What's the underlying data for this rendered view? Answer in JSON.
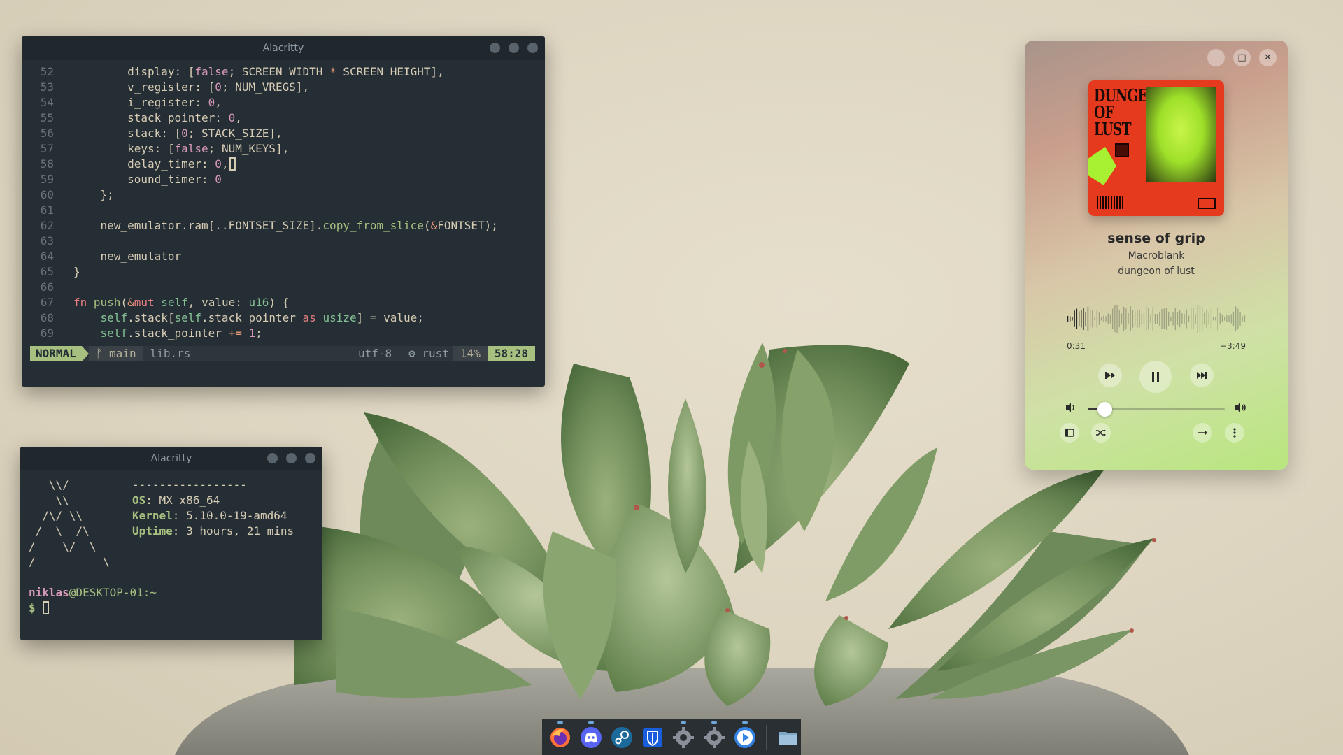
{
  "editor_window": {
    "title": "Alacritty",
    "code_lines": [
      {
        "n": "52",
        "html": "        display: [<span class=\"bool\">false</span>; SCREEN_WIDTH <span class=\"op\">*</span> SCREEN_HEIGHT],"
      },
      {
        "n": "53",
        "html": "        v_register: [<span class=\"num\">0</span>; NUM_VREGS],"
      },
      {
        "n": "54",
        "html": "        i_register: <span class=\"num\">0</span>,"
      },
      {
        "n": "55",
        "html": "        stack_pointer: <span class=\"num\">0</span>,"
      },
      {
        "n": "56",
        "html": "        stack: [<span class=\"num\">0</span>; STACK_SIZE],"
      },
      {
        "n": "57",
        "html": "        keys: [<span class=\"bool\">false</span>; NUM_KEYS],"
      },
      {
        "n": "58",
        "html": "        delay_timer: <span class=\"num\">0</span>,<span class=\"cursor-box\"></span>"
      },
      {
        "n": "59",
        "html": "        sound_timer: <span class=\"num\">0</span>"
      },
      {
        "n": "60",
        "html": "    };"
      },
      {
        "n": "61",
        "html": ""
      },
      {
        "n": "62",
        "html": "    new_emulator.ram[..FONTSET_SIZE].<span class=\"fn\">copy_from_slice</span>(<span class=\"op\">&amp;</span>FONTSET);"
      },
      {
        "n": "63",
        "html": ""
      },
      {
        "n": "64",
        "html": "    new_emulator"
      },
      {
        "n": "65",
        "html": "}"
      },
      {
        "n": "66",
        "html": ""
      },
      {
        "n": "67",
        "html": "<span class=\"kw\">fn</span> <span class=\"fn\">push</span>(<span class=\"op\">&amp;</span><span class=\"kw\">mut</span> <span class=\"ty\">self</span>, value: <span class=\"ty\">u16</span>) {"
      },
      {
        "n": "68",
        "html": "    <span class=\"ty\">self</span>.stack[<span class=\"ty\">self</span>.stack_pointer <span class=\"kw\">as</span> <span class=\"ty\">usize</span>] = value;"
      },
      {
        "n": "69",
        "html": "    <span class=\"ty\">self</span>.stack_pointer <span class=\"op\">+=</span> <span class=\"num\">1</span>;"
      }
    ],
    "status": {
      "mode": "NORMAL",
      "branch_icon": "ᚠ",
      "branch": "main",
      "file": "lib.rs",
      "encoding": "utf-8",
      "os_icon": "",
      "filetype_icon": "⚙",
      "filetype": "rust",
      "percent": "14%",
      "position": "58:28"
    }
  },
  "fetch_window": {
    "title": "Alacritty",
    "logo": "   \\\\/\n    \\\\\n  /\\/ \\\\\n /  \\  /\\\n/    \\/  \\\n/__________\\",
    "separator": "-----------------",
    "os_label": "OS",
    "os_value": "MX x86_64",
    "kernel_label": "Kernel",
    "kernel_value": "5.10.0-19-amd64",
    "uptime_label": "Uptime",
    "uptime_value": "3 hours, 21 mins",
    "prompt_user": "niklas",
    "prompt_host": "@DESKTOP-01:~",
    "prompt_symbol": "$"
  },
  "player": {
    "album_cover_title": "DUNGEON OF LUST",
    "track_title": "sense of grip",
    "artist": "Macroblank",
    "album": "dungeon of lust",
    "time_elapsed": "0:31",
    "time_remaining": "−3:49",
    "progress": 0.12,
    "volume": 0.12,
    "minimize_icon": "_",
    "maximize_icon": "□",
    "close_icon": "✕"
  },
  "dock": {
    "apps": [
      {
        "name": "firefox",
        "color": "#ff7139",
        "running": true
      },
      {
        "name": "discord",
        "color": "#5865f2",
        "running": true
      },
      {
        "name": "steam",
        "color": "#1b6a9a",
        "running": false
      },
      {
        "name": "bitwarden",
        "color": "#175ddc",
        "running": false
      },
      {
        "name": "settings",
        "color": "#8a9099",
        "running": true
      },
      {
        "name": "settings-2",
        "color": "#8a9099",
        "running": true
      },
      {
        "name": "media-player",
        "color": "#3584e4",
        "running": true
      },
      {
        "name": "files",
        "color": "#7fa7c6",
        "running": false
      }
    ]
  }
}
